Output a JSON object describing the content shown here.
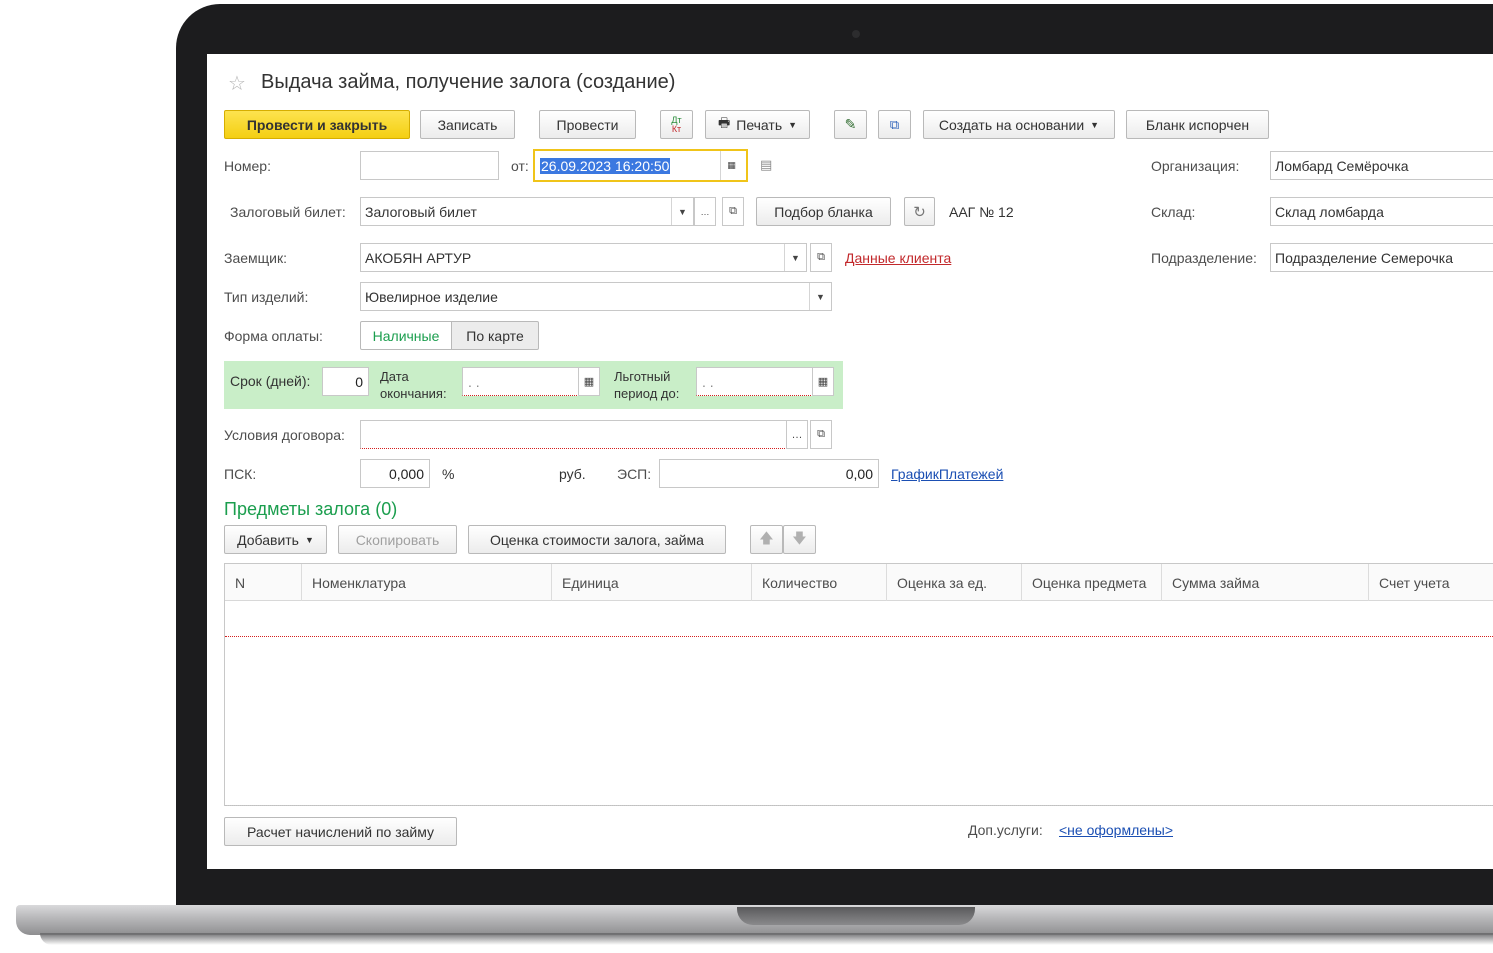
{
  "window": {
    "title": "Выдача займа, получение залога (создание)"
  },
  "toolbar": {
    "post_close": "Провести и закрыть",
    "save": "Записать",
    "post": "Провести",
    "dtkt_top": "Дт",
    "dtkt_bottom": "Кт",
    "print": "Печать",
    "create_based": "Создать на основании",
    "blank_spoiled": "Бланк испорчен"
  },
  "header": {
    "number_label": "Номер:",
    "number_value": "",
    "date_label": "от:",
    "date_value": "26.09.2023 16:20:50",
    "organization_label": "Организация:",
    "organization_value": "Ломбард Семёрочка",
    "warehouse_label": "Склад:",
    "warehouse_value": "Склад ломбарда",
    "department_label": "Подразделение:",
    "department_value": "Подразделение Семерочка"
  },
  "form": {
    "ticket_label": "Залоговый билет:",
    "ticket_value": "Залоговый билет",
    "pick_blank": "Подбор бланка",
    "ticket_number": "ААГ № 12",
    "borrower_label": "Заемщик:",
    "borrower_value": "АКОБЯН АРТУР",
    "client_data_link": "Данные клиента",
    "item_type_label": "Тип изделий:",
    "item_type_value": "Ювелирное изделие",
    "payment_form_label": "Форма оплаты:",
    "payment_cash": "Наличные",
    "payment_card": "По карте",
    "term_label": "Срок (дней):",
    "term_value": "0",
    "end_date_label_1": "Дата",
    "end_date_label_2": "окончания:",
    "end_date_value": ". .",
    "grace_label_1": "Льготный",
    "grace_label_2": "период до:",
    "grace_value": ". .",
    "contract_terms_label": "Условия договора:",
    "contract_terms_value": "",
    "psk_label": "ПСК:",
    "psk_value": "0,000",
    "psk_unit": "%",
    "rub_label": "руб.",
    "esp_label": "ЭСП:",
    "esp_value": "0,00",
    "payment_schedule_link": "ГрафикПлатежей"
  },
  "pledge": {
    "section_title": "Предметы залога (0)",
    "add": "Добавить",
    "copy": "Скопировать",
    "valuation": "Оценка стоимости залога, займа",
    "columns": [
      "N",
      "Номенклатура",
      "Единица",
      "Количество",
      "Оценка за ед.",
      "Оценка предмета",
      "Сумма займа",
      "Счет учета"
    ]
  },
  "footer": {
    "calc_button": "Расчет начислений по займу",
    "extra_services_label": "Доп.услуги:",
    "extra_services_link": "<не оформлены>"
  },
  "colors": {
    "primary_button": "#f4cf12",
    "section_green": "#1b9e4e",
    "panel_green": "#c9eec8",
    "link_red": "#c2282b",
    "link_blue": "#1b4fb3"
  }
}
